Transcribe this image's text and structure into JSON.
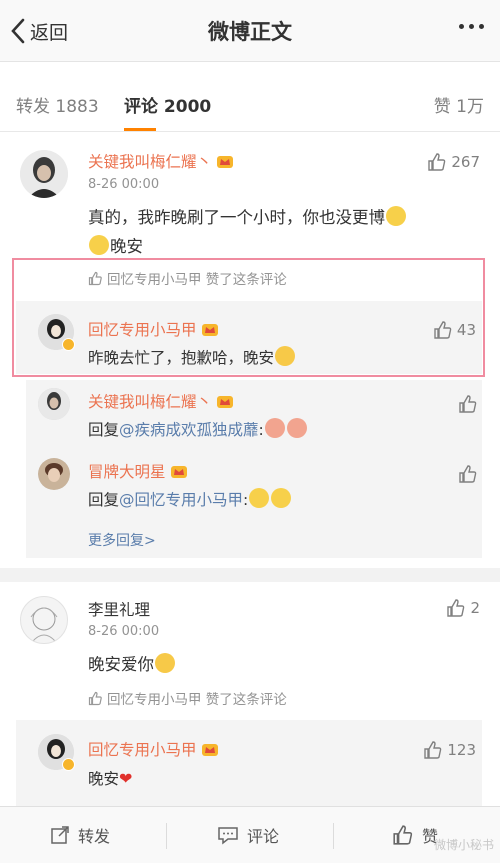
{
  "nav": {
    "back_label": "返回",
    "title": "微博正文"
  },
  "tabs": {
    "repost": "转发 1883",
    "comments": "评论 2000",
    "likes": "赞 1万"
  },
  "comments": [
    {
      "username": "关键我叫梅仁耀丶",
      "time": "8-26 00:00",
      "likes": "267",
      "text_line1": "真的，我昨晚刷了一个小时，你也没更博",
      "text_line2": "晚安",
      "liked_by": "回忆专用小马甲 赞了这条评论",
      "author_reply": {
        "username": "回忆专用小马甲",
        "likes": "43",
        "text": "昨晚去忙了，抱歉哈，晚安"
      },
      "sub_replies": [
        {
          "username": "关键我叫梅仁耀丶",
          "prefix": "回复",
          "mention": "@疾病成欢孤独成蘼",
          "suffix": ":"
        },
        {
          "username": "冒牌大明星",
          "prefix": "回复",
          "mention": "@回忆专用小马甲",
          "suffix": ":"
        }
      ],
      "more_replies": "更多回复>"
    },
    {
      "username": "李里礼理",
      "time": "8-26 00:00",
      "likes": "2",
      "text": "晚安爱你",
      "liked_by": "回忆专用小马甲 赞了这条评论",
      "author_reply": {
        "username": "回忆专用小马甲",
        "likes": "123",
        "text": "晚安"
      }
    }
  ],
  "bottom": {
    "repost": "转发",
    "comment": "评论",
    "like": "赞"
  },
  "watermark": "微博小秘书",
  "colors": {
    "accent": "#ff8200",
    "username": "#eb7350",
    "link": "#5a7dab",
    "highlight": "#f08ca0"
  }
}
